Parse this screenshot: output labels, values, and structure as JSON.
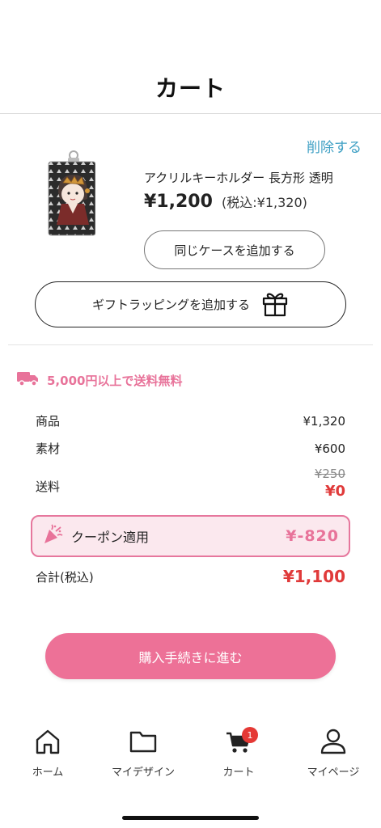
{
  "header": {
    "title": "カート"
  },
  "cart_item": {
    "delete_label": "削除する",
    "thumbnail_icon": "acrylic-keychain-thumbnail",
    "product_name": "アクリルキーホルダー 長方形 透明",
    "price": "¥1,200",
    "price_tax_included": "(税込:¥1,320)",
    "add_same_case_label": "同じケースを追加する"
  },
  "gift": {
    "label": "ギフトラッピングを追加する",
    "icon": "gift-icon"
  },
  "shipping_banner": {
    "icon": "truck-icon",
    "text": "5,000円以上で送料無料"
  },
  "summary": {
    "goods_label": "商品",
    "goods_value": "¥1,320",
    "material_label": "素材",
    "material_value": "¥600",
    "shipping_label": "送料",
    "shipping_original": "¥250",
    "shipping_discounted": "¥0",
    "coupon_icon": "party-popper-icon",
    "coupon_label": "クーポン適用",
    "coupon_value": "¥-820",
    "total_label": "合計(税込)",
    "total_value": "¥1,100"
  },
  "cta": {
    "label": "購入手続きに進む"
  },
  "tabbar": {
    "items": [
      {
        "label": "ホーム",
        "icon": "home-icon"
      },
      {
        "label": "マイデザイン",
        "icon": "folder-icon"
      },
      {
        "label": "カート",
        "icon": "cart-icon",
        "badge": "1"
      },
      {
        "label": "マイページ",
        "icon": "user-icon"
      }
    ]
  },
  "colors": {
    "accent_pink": "#ed7197",
    "link_blue": "#3fa0c4",
    "price_red": "#e03a3a",
    "coupon_bg": "#fbe8ee"
  }
}
